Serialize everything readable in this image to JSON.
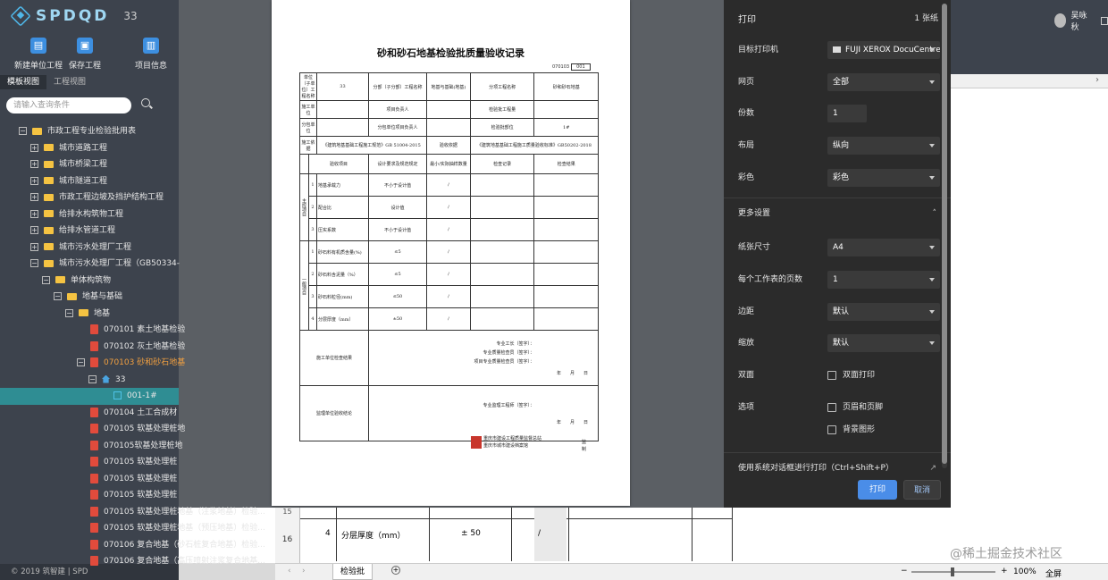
{
  "app": {
    "logo": "SPDQD",
    "version": "33",
    "footer": "© 2019 筑智建 | SPD",
    "user": "吴咏秋"
  },
  "toolbar": {
    "new_unit": "新建单位工程",
    "save": "保存工程",
    "project_info": "项目信息"
  },
  "tabs": [
    "模板视图",
    "工程视图"
  ],
  "search": {
    "placeholder": "请输入查询条件"
  },
  "tree": [
    {
      "label": "市政工程专业检验批用表",
      "indent": 1,
      "icon": "folder",
      "exp": "−"
    },
    {
      "label": "城市道路工程",
      "indent": 2,
      "icon": "folder",
      "exp": "+"
    },
    {
      "label": "城市桥梁工程",
      "indent": 2,
      "icon": "folder",
      "exp": "+"
    },
    {
      "label": "城市隧道工程",
      "indent": 2,
      "icon": "folder",
      "exp": "+"
    },
    {
      "label": "市政工程边坡及挡护结构工程",
      "indent": 2,
      "icon": "folder",
      "exp": "+"
    },
    {
      "label": "给排水构筑物工程",
      "indent": 2,
      "icon": "folder",
      "exp": "+"
    },
    {
      "label": "给排水管道工程",
      "indent": 2,
      "icon": "folder",
      "exp": "+"
    },
    {
      "label": "城市污水处理厂工程",
      "indent": 2,
      "icon": "folder",
      "exp": "+"
    },
    {
      "label": "城市污水处理厂工程（GB50334-",
      "indent": 2,
      "icon": "folder",
      "exp": "−"
    },
    {
      "label": "单体构筑物",
      "indent": 3,
      "icon": "folder",
      "exp": "−"
    },
    {
      "label": "地基与基础",
      "indent": 4,
      "icon": "folder",
      "exp": "−"
    },
    {
      "label": "地基",
      "indent": 5,
      "icon": "folder",
      "exp": "−"
    },
    {
      "label": "070101 素土地基检验",
      "indent": 6,
      "icon": "doc",
      "exp": ""
    },
    {
      "label": "070102 灰土地基检验",
      "indent": 6,
      "icon": "doc",
      "exp": ""
    },
    {
      "label": "070103 砂和砂石地基",
      "indent": 6,
      "icon": "doc",
      "exp": "−",
      "orange": true
    },
    {
      "label": "33",
      "indent": 7,
      "icon": "house",
      "exp": "−"
    },
    {
      "label": "001-1#",
      "indent": 8,
      "icon": "sheet",
      "exp": "",
      "selected": true
    },
    {
      "label": "070104 土工合成材",
      "indent": 6,
      "icon": "doc",
      "exp": ""
    },
    {
      "label": "070105 软基处理桩地",
      "indent": 6,
      "icon": "doc",
      "exp": ""
    },
    {
      "label": "070105软基处理桩地",
      "indent": 6,
      "icon": "doc",
      "exp": ""
    },
    {
      "label": "070105 软基处理桩",
      "indent": 6,
      "icon": "doc",
      "exp": ""
    },
    {
      "label": "070105 软基处理桩",
      "indent": 6,
      "icon": "doc",
      "exp": ""
    },
    {
      "label": "070105 软基处理桩",
      "indent": 6,
      "icon": "doc",
      "exp": ""
    },
    {
      "label": "070105 软基处理桩地基（注浆地基）检验...",
      "indent": 6,
      "icon": "doc",
      "exp": ""
    },
    {
      "label": "070105 软基处理桩地基（预压地基）检验...",
      "indent": 6,
      "icon": "doc",
      "exp": ""
    },
    {
      "label": "070106 复合地基（砂石桩复合地基）检验...",
      "indent": 6,
      "icon": "doc",
      "exp": ""
    },
    {
      "label": "070106 复合地基（高压喷射注浆复合地基...",
      "indent": 6,
      "icon": "doc",
      "exp": ""
    }
  ],
  "document": {
    "title": "砂和砂石地基检验批质量验收记录",
    "code": "070103",
    "code_no": "001",
    "header_rows": [
      [
        "单位（子单位）工程名称",
        "33",
        "分部（子分部）工程名称",
        "地基与基础(地基)",
        "分项工程名称",
        "砂和砂石地基"
      ],
      [
        "施工单位",
        "",
        "项目负责人",
        "",
        "检验批工程量",
        ""
      ],
      [
        "分包单位",
        "",
        "分包单位项目负责人",
        "",
        "检验批部位",
        "1#"
      ]
    ],
    "basis_label": "施工依据",
    "basis_value": "《建筑地基基础工程施工规范》GB 51004-2015",
    "accept_basis_label": "验收依据",
    "accept_basis_value": "《建筑地基基础工程施工质量验收标准》GB50202-2018",
    "col_headers": [
      "验收项目",
      "设计要求及规范规定",
      "最小/实际抽样数量",
      "检查记录",
      "检查结果"
    ],
    "main_label": "主控项目",
    "general_label": "一般项目",
    "main_items": [
      [
        "1",
        "地基承载力",
        "不小于设计值",
        "/"
      ],
      [
        "2",
        "配合比",
        "设计值",
        "/"
      ],
      [
        "3",
        "压实系数",
        "不小于设计值",
        "/"
      ]
    ],
    "general_items": [
      [
        "1",
        "砂石料有机质含量(%)",
        "≤5",
        "/"
      ],
      [
        "2",
        "砂石料含泥量（%）",
        "≤5",
        "/"
      ],
      [
        "3",
        "砂石料粒径(mm)",
        "≤50",
        "/"
      ],
      [
        "4",
        "分层厚度（mm）",
        "±50",
        "/"
      ]
    ],
    "construction_check": "施工单位检查结果",
    "construction_sign": "专业工长（签字）：\n专业质量检查员（签字）：\n项目专业质量检查员（签字）：",
    "supervision_check": "监理单位验收结论",
    "supervision_sign": "专业监理工程师（签字）：",
    "date": "年　　月　　日",
    "issuer1": "重庆市建设工程质量监督总站",
    "issuer2": "重庆市城市建设档案馆",
    "issuer_suffix": "监制"
  },
  "sheet": {
    "row15": "15",
    "row16": "16",
    "item_no": "4",
    "item_label": "分层厚度（mm）",
    "item_value": "± 50",
    "item_count": "/",
    "tab": "检验批",
    "zoom": "100%",
    "fullscreen": "全屏"
  },
  "dialog": {
    "title": "打印",
    "sheets": "1 张纸",
    "printer_label": "目标打印机",
    "printer": "FUJI XEROX DocuCentre",
    "pages_label": "网页",
    "pages": "全部",
    "copies_label": "份数",
    "copies": "1",
    "layout_label": "布局",
    "layout": "纵向",
    "color_label": "彩色",
    "color": "彩色",
    "more": "更多设置",
    "paper_label": "纸张尺寸",
    "paper": "A4",
    "per_sheet_label": "每个工作表的页数",
    "per_sheet": "1",
    "margin_label": "边距",
    "margin": "默认",
    "scale_label": "缩放",
    "scale": "默认",
    "duplex_label": "双面",
    "duplex": "双面打印",
    "options_label": "选项",
    "headers": "页眉和页脚",
    "bg": "背景图形",
    "system_dialog": "使用系统对话框进行打印（Ctrl+Shift+P）",
    "print_btn": "打印",
    "cancel_btn": "取消"
  },
  "watermark": "@稀土掘金技术社区"
}
